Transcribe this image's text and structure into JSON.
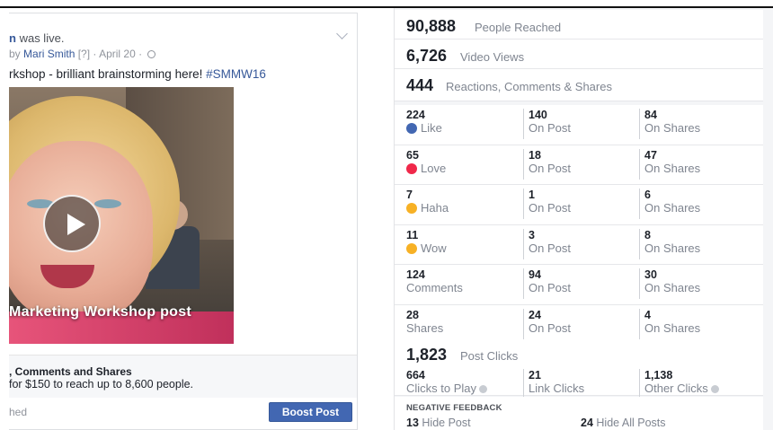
{
  "post": {
    "status_suffix": "was live.",
    "status_name_fragment": "n",
    "by_prefix": "by",
    "author": "Mari Smith",
    "meta": "[?] · April 20 ·",
    "text": "rkshop - brilliant brainstorming here!",
    "hashtag": "#SMMW16",
    "video_caption": "Marketing Workshop post",
    "boost_title": ", Comments and Shares",
    "boost_subtitle": "for $150 to reach up to 8,600 people.",
    "reached_fragment": "hed",
    "boost_button": "Boost Post",
    "icons": [
      "globe-icon",
      "chevron-down-icon",
      "play-icon"
    ]
  },
  "insights": {
    "people_reached": {
      "value": "90,888",
      "label": "People Reached"
    },
    "video_views": {
      "value": "6,726",
      "label": "Video Views"
    },
    "engagement": {
      "value": "444",
      "label": "Reactions, Comments & Shares"
    },
    "breakdown": [
      {
        "total": "224",
        "label": "Like",
        "icon": "like-icon",
        "icon_color": "#4267b2",
        "on_post": "140",
        "on_post_label": "On Post",
        "on_shares": "84",
        "on_shares_label": "On Shares"
      },
      {
        "total": "65",
        "label": "Love",
        "icon": "love-icon",
        "icon_color": "#f0284a",
        "on_post": "18",
        "on_post_label": "On Post",
        "on_shares": "47",
        "on_shares_label": "On Shares"
      },
      {
        "total": "7",
        "label": "Haha",
        "icon": "haha-icon",
        "icon_color": "#f7b125",
        "on_post": "1",
        "on_post_label": "On Post",
        "on_shares": "6",
        "on_shares_label": "On Shares"
      },
      {
        "total": "11",
        "label": "Wow",
        "icon": "wow-icon",
        "icon_color": "#f7b125",
        "on_post": "3",
        "on_post_label": "On Post",
        "on_shares": "8",
        "on_shares_label": "On Shares"
      },
      {
        "total": "124",
        "label": "Comments",
        "icon": "",
        "icon_color": "",
        "on_post": "94",
        "on_post_label": "On Post",
        "on_shares": "30",
        "on_shares_label": "On Shares"
      },
      {
        "total": "28",
        "label": "Shares",
        "icon": "",
        "icon_color": "",
        "on_post": "24",
        "on_post_label": "On Post",
        "on_shares": "4",
        "on_shares_label": "On Shares"
      }
    ],
    "post_clicks": {
      "value": "1,823",
      "label": "Post Clicks",
      "items": [
        {
          "value": "664",
          "label": "Clicks to Play"
        },
        {
          "value": "21",
          "label": "Link Clicks"
        },
        {
          "value": "1,138",
          "label": "Other Clicks"
        }
      ]
    },
    "negative_feedback": {
      "title": "NEGATIVE FEEDBACK",
      "hide_post": {
        "value": "13",
        "label": "Hide Post"
      },
      "hide_all": {
        "value": "24",
        "label": "Hide All Posts"
      }
    }
  },
  "colors": {
    "link": "#365899",
    "button": "#4267b2",
    "muted": "#7f8590"
  }
}
